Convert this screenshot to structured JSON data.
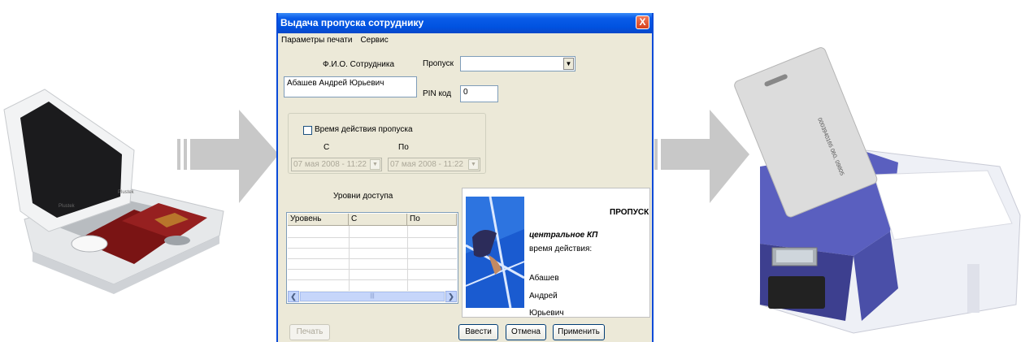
{
  "window": {
    "title": "Выдача пропуска сотруднику",
    "close_glyph": "X",
    "menu": [
      "Параметры печати",
      "Сервис"
    ]
  },
  "form": {
    "fio_label": "Ф.И.О. Сотрудника",
    "fio_value": "Абашев Андрей Юрьевич",
    "pass_label": "Пропуск",
    "pass_value": "",
    "pin_label": "PIN код",
    "pin_value": "0",
    "validity_checkbox_label": "Время действия пропуска",
    "validity_checked": false,
    "from_label": "С",
    "to_label": "По",
    "from_date": "07   мая   2008 - 11:22",
    "to_date": "07   мая   2008 - 11:22"
  },
  "access": {
    "title": "Уровни доступа",
    "columns": [
      "Уровень",
      "С",
      "По"
    ],
    "rows": []
  },
  "card": {
    "header": "ПРОПУСК",
    "checkpoint": "центральное КП",
    "validity": "время действия:",
    "surname": "Абашев",
    "name": "Андрей",
    "patronymic": "Юрьевич"
  },
  "buttons": {
    "print": "Печать",
    "enter": "Ввести",
    "cancel": "Отмена",
    "apply": "Применить"
  },
  "colors": {
    "titlebar": "#0052e0",
    "window_bg": "#ece9d8",
    "arrow": "#c8c8c8",
    "card_blue": "#1a5bd0",
    "printer_purple": "#5a5fbf"
  },
  "icons": [
    "scanner-icon",
    "arrow-right-icon",
    "close-icon",
    "printer-icon",
    "card-icon"
  ]
}
